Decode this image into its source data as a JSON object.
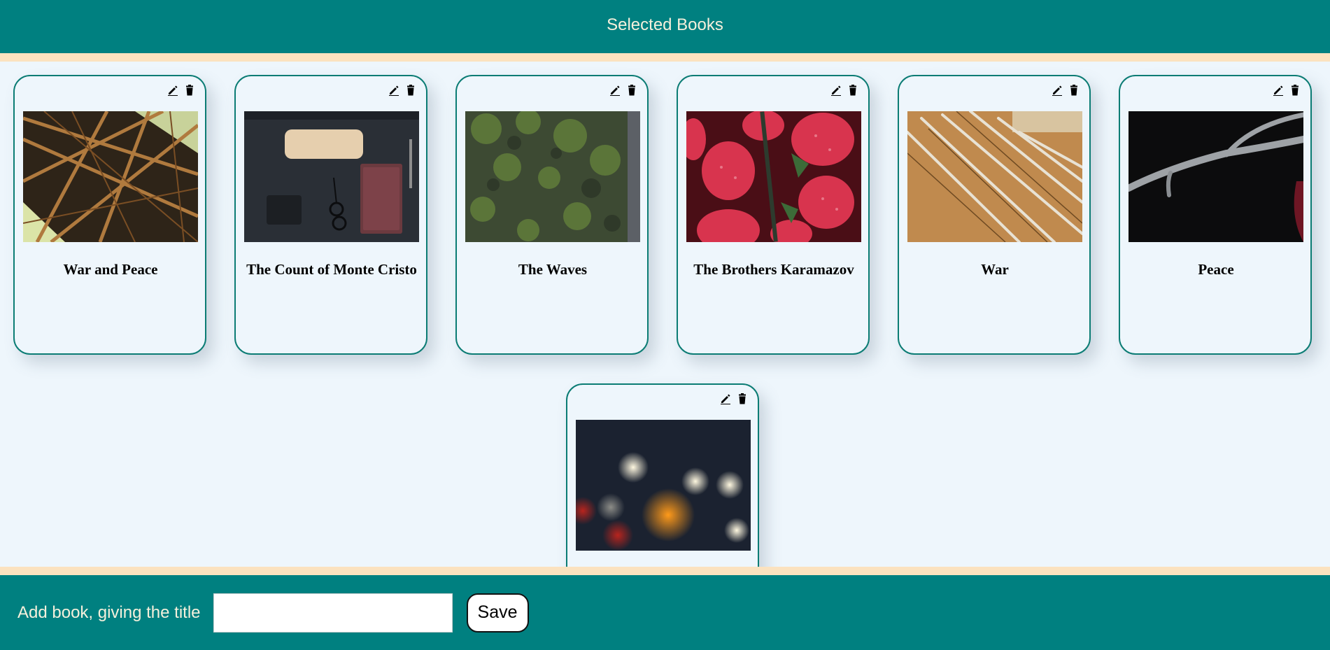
{
  "header": {
    "title": "Selected Books"
  },
  "icons": {
    "edit": "pencil-icon",
    "delete": "trash-icon"
  },
  "books": [
    {
      "title": "War and Peace",
      "image": "steel-lattice-structure"
    },
    {
      "title": "The Count of Monte Cristo",
      "image": "desk-notebook-glasses"
    },
    {
      "title": "The Waves",
      "image": "mossy-rock-wall"
    },
    {
      "title": "The Brothers Karamazov",
      "image": "strawberries"
    },
    {
      "title": "War",
      "image": "measuring-sticks"
    },
    {
      "title": "Peace",
      "image": "antler-on-black"
    },
    {
      "title": "",
      "image": "bokeh-lights"
    }
  ],
  "footer": {
    "add_label": "Add book, giving the title",
    "input_value": "",
    "save_label": "Save"
  },
  "colors": {
    "teal": "#008080",
    "beige": "#fbe2bf",
    "card_border": "#0b7c74",
    "background": "#eef6fc"
  }
}
